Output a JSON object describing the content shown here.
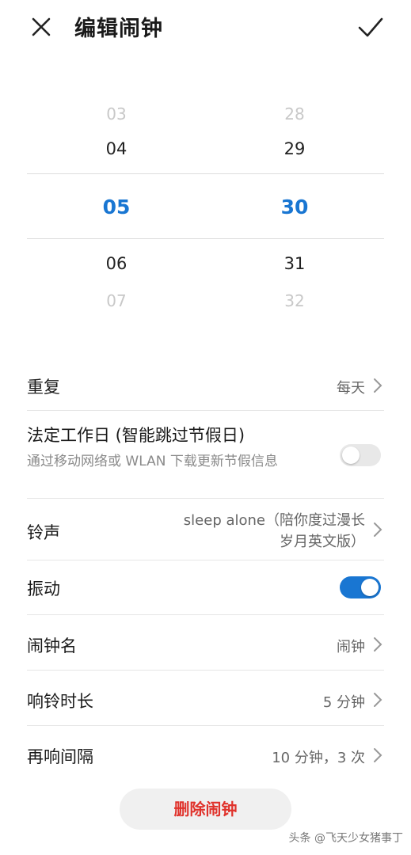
{
  "header": {
    "title": "编辑闹钟",
    "close_icon": "close-icon",
    "confirm_icon": "checkmark-icon"
  },
  "picker": {
    "hour": {
      "far_above": "03",
      "above": "04",
      "selected": "05",
      "below": "06",
      "far_below": "07"
    },
    "minute": {
      "far_above": "28",
      "above": "29",
      "selected": "30",
      "below": "31",
      "far_below": "32"
    },
    "selected_color": "#1976d2"
  },
  "settings": {
    "repeat": {
      "label": "重复",
      "value": "每天"
    },
    "workday": {
      "label": "法定工作日 (智能跳过节假日)",
      "description": "通过移动网络或 WLAN 下载更新节假信息",
      "enabled": false
    },
    "ringtone": {
      "label": "铃声",
      "value_line1": "sleep alone（陪你度过漫长",
      "value_line2": "岁月英文版）"
    },
    "vibrate": {
      "label": "振动",
      "enabled": true
    },
    "alarm_name": {
      "label": "闹钟名",
      "value": "闹钟"
    },
    "ring_duration": {
      "label": "响铃时长",
      "value": "5 分钟"
    },
    "snooze": {
      "label": "再响间隔",
      "value": "10 分钟，3 次"
    }
  },
  "delete_button": {
    "label": "删除闹钟",
    "color": "#e0322b"
  },
  "watermark": "头条 @飞天少女猪事丁",
  "colors": {
    "accent": "#1976d2",
    "toggle_off": "#e8e8e8"
  }
}
